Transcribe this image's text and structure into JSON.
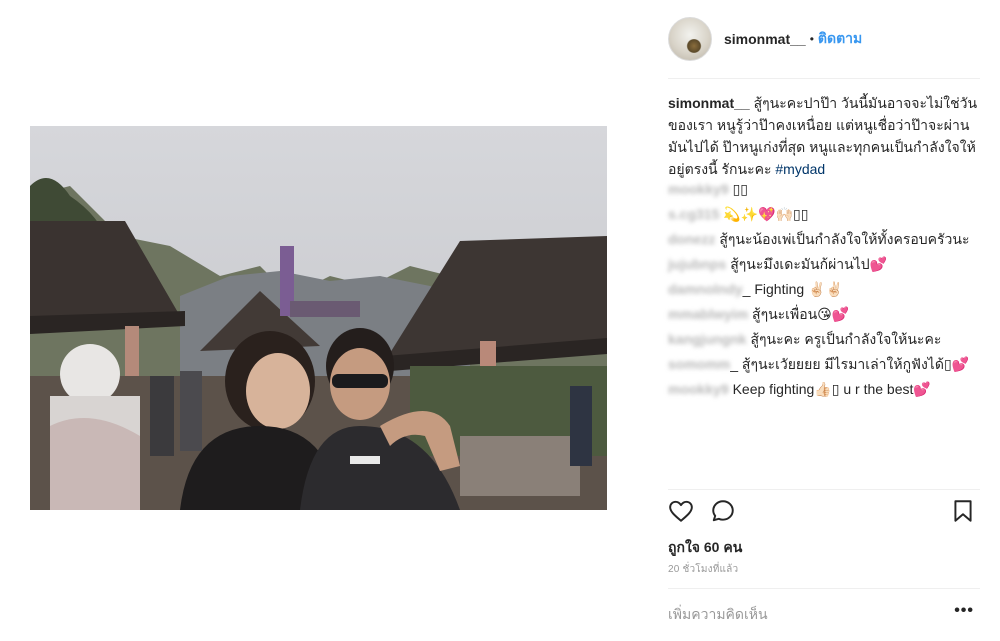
{
  "header": {
    "username": "simonmat__",
    "separator": "•",
    "follow_label": "ติดตาม"
  },
  "caption": {
    "username": "simonmat__",
    "text": " สู้ๆนะคะปาป๊า วันนี้มันอาจจะไม่ใช่วันของเรา หนูรู้ว่าป๊าคงเหนื่อย แต่หนูเชื่อว่าป๊าจะผ่านมันไปได้ ป๊าหนูเก่งที่สุด หนูและทุกคนเป็นกำลังใจให้อยู่ตรงนี้ รักนะคะ ",
    "hashtag": "#mydad"
  },
  "comments": [
    {
      "user": "mookky9",
      "text": " ▯▯"
    },
    {
      "user": "s.cg315",
      "text": " 💫✨💖🙌🏻▯▯"
    },
    {
      "user": "donezz",
      "text": " สู้ๆนะน้องเพ่เป็นกำลังใจให้ทั้งครอบครัวนะ"
    },
    {
      "user": "jujubnps",
      "text": " สู้ๆนะมึงเดะมันก้ผ่านไป💕"
    },
    {
      "user": "damnolndy",
      "text": "_ Fighting ✌🏻✌🏻"
    },
    {
      "user": "mmablwyim",
      "text": " สู้ๆนะเพื่อน😘💕"
    },
    {
      "user": "kangjungnk",
      "text": " สู้ๆนะคะ ครูเป็นกำลังใจให้นะคะ"
    },
    {
      "user": "somomm",
      "text": "_ สู้ๆนะเวัยยยย มีไรมาเล่าให้กูฟังได้▯💕"
    },
    {
      "user": "mookky9",
      "text": " Keep fighting👍🏻▯ u r the best💕"
    }
  ],
  "actions": {
    "like_icon": "heart-icon",
    "comment_icon": "comment-icon",
    "save_icon": "bookmark-icon"
  },
  "likes_text": "ถูกใจ 60 คน",
  "time_text": "20 ชั่วโมงที่แล้ว",
  "add_comment_placeholder": "เพิ่มความคิดเห็น",
  "more_label": "•••",
  "colors": {
    "link_blue": "#3897f0",
    "hashtag": "#003569",
    "text": "#262626",
    "muted": "#999999"
  }
}
